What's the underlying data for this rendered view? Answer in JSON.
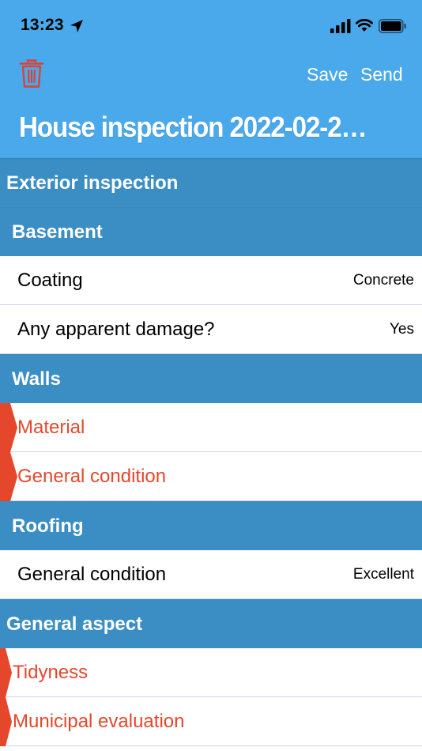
{
  "status": {
    "time": "13:23"
  },
  "toolbar": {
    "save_label": "Save",
    "send_label": "Send"
  },
  "title": "House inspection 2022-02-2…",
  "colors": {
    "header": "#4aa9ea",
    "section": "#3b8ec4",
    "error": "#e5472c",
    "separator": "#c9d1ef"
  },
  "sections": [
    {
      "label": "Exterior inspection",
      "groups": [
        {
          "label": "Basement",
          "items": [
            {
              "label": "Coating",
              "value": "Concrete"
            },
            {
              "label": "Any apparent damage?",
              "value": "Yes"
            }
          ]
        },
        {
          "label": "Walls",
          "items": [
            {
              "label": "Material",
              "value": ""
            },
            {
              "label": "General condition",
              "value": ""
            }
          ]
        },
        {
          "label": "Roofing",
          "items": [
            {
              "label": "General condition",
              "value": "Excellent"
            }
          ]
        }
      ]
    },
    {
      "label": "General aspect",
      "items": [
        {
          "label": "Tidyness",
          "value": ""
        },
        {
          "label": "Municipal evaluation",
          "value": ""
        }
      ]
    }
  ]
}
